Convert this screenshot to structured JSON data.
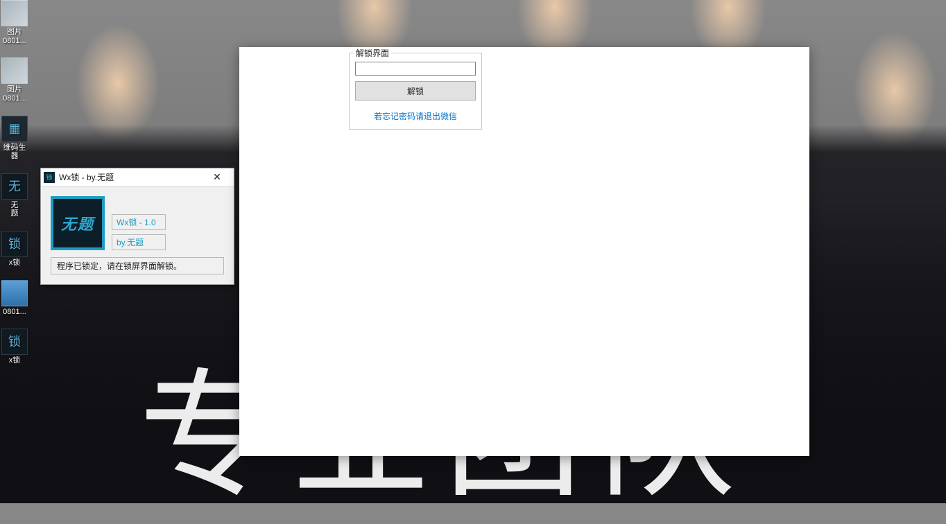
{
  "wallpaper": {
    "big_text": "专业团队"
  },
  "desktop": {
    "icons": [
      {
        "label": "图片",
        "sub": "0801..."
      },
      {
        "label": "图片",
        "sub": "0801..."
      },
      {
        "label": "维码生",
        "sub": "器"
      },
      {
        "label": "无",
        "sub": "题"
      },
      {
        "label": "x锁",
        "sub": ""
      },
      {
        "label": "",
        "sub": "0801..."
      },
      {
        "label": "x锁",
        "sub": ""
      }
    ]
  },
  "app_window": {
    "title": "Wx锁 - by.无题",
    "logo_text": "无题",
    "version_label": "Wx锁 - 1.0",
    "author_label": "by.无题",
    "status_text": "程序已锁定，请在锁屏界面解锁。"
  },
  "lock_panel": {
    "group_title": "解锁界面",
    "password_value": "",
    "unlock_button": "解锁",
    "forgot_link": "若忘记密码请退出微信"
  }
}
